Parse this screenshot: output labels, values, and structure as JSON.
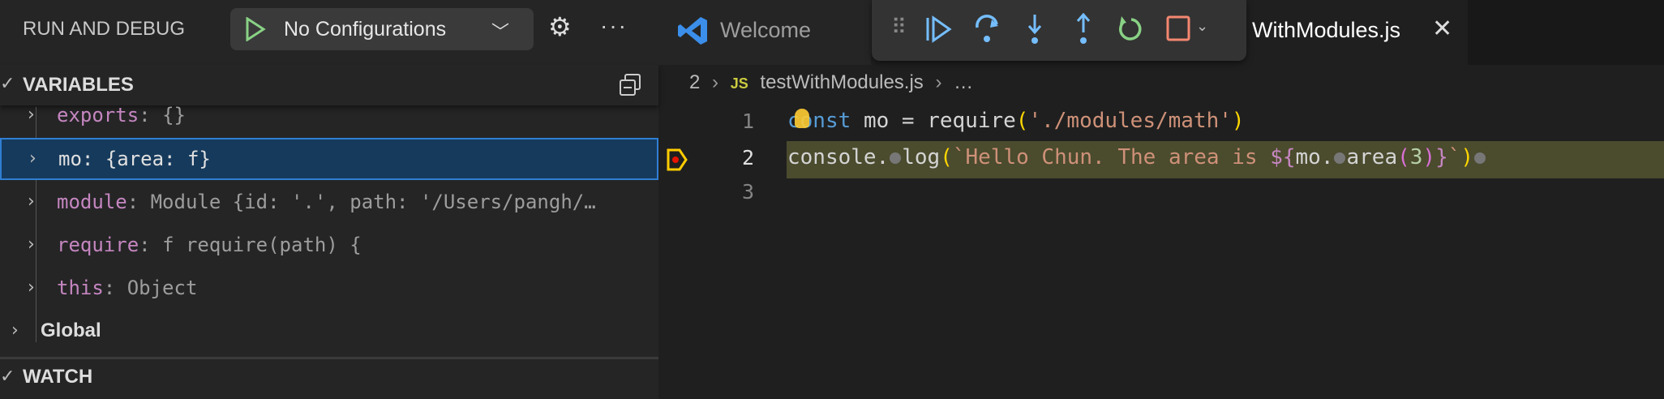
{
  "sidebar": {
    "title": "RUN AND DEBUG",
    "config_label": "No Configurations",
    "variables_label": "VARIABLES",
    "variables": [
      {
        "name": "exports",
        "value": "{}"
      },
      {
        "name": "mo",
        "value": "{area: f}"
      },
      {
        "name": "module",
        "value": "Module {id: '.', path: '/Users/pangh/…"
      },
      {
        "name": "require",
        "value": "f require(path) {"
      },
      {
        "name": "this",
        "value": "Object"
      }
    ],
    "global_label": "Global",
    "watch_label": "WATCH"
  },
  "tabs": [
    {
      "label": "Welcome"
    },
    {
      "label": "WithModules.js"
    }
  ],
  "breadcrumb": {
    "prefix": "2",
    "file": "testWithModules.js",
    "rest": "…",
    "js_badge": "JS"
  },
  "editor": {
    "lines": [
      {
        "number": "1",
        "text": "const mo = require('./modules/math')"
      },
      {
        "number": "2",
        "text": "console.log(`Hello Chun. The area is ${mo.area(3)}`)"
      },
      {
        "number": "3",
        "text": ""
      }
    ],
    "current_line": 2
  },
  "colors": {
    "accent": "#2f7fd3",
    "highlight": "#4b4b2e",
    "keyword": "#569cd6",
    "string": "#ce9178",
    "property": "#c586c0"
  }
}
